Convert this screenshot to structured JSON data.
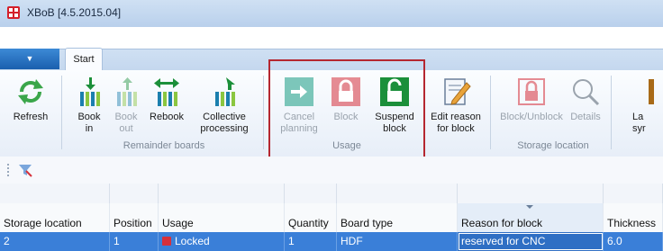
{
  "window": {
    "title": "XBoB [4.5.2015.04]"
  },
  "ribbon_tabs": {
    "app_menu": "▼",
    "start": "Start"
  },
  "ribbon": {
    "refresh": {
      "line1": "Refresh",
      "line2": ""
    },
    "remainder_boards": {
      "label": "Remainder boards",
      "book_in": {
        "line1": "Book",
        "line2": "in"
      },
      "book_out": {
        "line1": "Book",
        "line2": "out"
      },
      "rebook": {
        "line1": "Rebook",
        "line2": ""
      },
      "collective": {
        "line1": "Collective",
        "line2": "processing"
      }
    },
    "usage": {
      "label": "Usage",
      "cancel_planning": {
        "line1": "Cancel",
        "line2": "planning"
      },
      "block": {
        "line1": "Block",
        "line2": ""
      },
      "suspend_block": {
        "line1": "Suspend",
        "line2": "block"
      }
    },
    "edit_reason": {
      "line1": "Edit reason",
      "line2": "for block"
    },
    "storage_location": {
      "label": "Storage location",
      "block_unblock": {
        "line1": "Block/Unblock",
        "line2": ""
      },
      "details": {
        "line1": "Details",
        "line2": ""
      },
      "cut_label": {
        "line1": "La",
        "line2": "syr"
      }
    }
  },
  "grid": {
    "columns": [
      "Storage location",
      "Position",
      "Usage",
      "Quantity",
      "Board type",
      "Reason for block",
      "Thickness"
    ],
    "rows": [
      {
        "storage_location": "2",
        "position": "1",
        "usage": "Locked",
        "quantity": "1",
        "board_type": "HDF",
        "reason": "reserved for CNC",
        "thickness": "6.0"
      }
    ]
  },
  "colors": {
    "accent": "#3a7fd8",
    "highlight_border": "#b52730",
    "lock_red": "#d6303a",
    "teal": "#2aa48c",
    "green": "#1b8f3a"
  }
}
